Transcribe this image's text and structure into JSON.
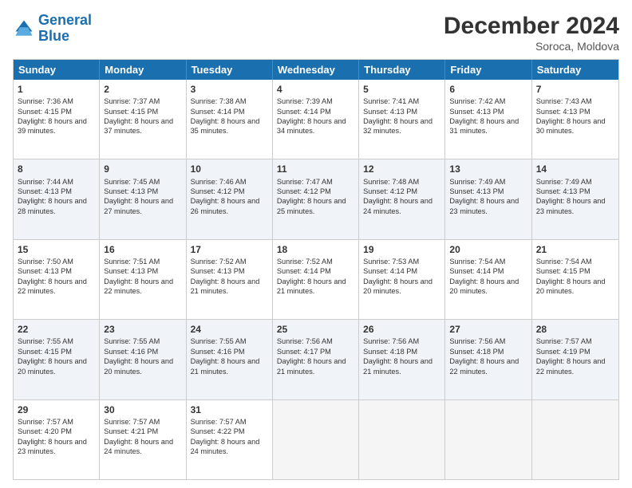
{
  "logo": {
    "line1": "General",
    "line2": "Blue"
  },
  "title": "December 2024",
  "subtitle": "Soroca, Moldova",
  "headers": [
    "Sunday",
    "Monday",
    "Tuesday",
    "Wednesday",
    "Thursday",
    "Friday",
    "Saturday"
  ],
  "rows": [
    [
      {
        "day": "1",
        "sunrise": "Sunrise: 7:36 AM",
        "sunset": "Sunset: 4:15 PM",
        "daylight": "Daylight: 8 hours and 39 minutes."
      },
      {
        "day": "2",
        "sunrise": "Sunrise: 7:37 AM",
        "sunset": "Sunset: 4:15 PM",
        "daylight": "Daylight: 8 hours and 37 minutes."
      },
      {
        "day": "3",
        "sunrise": "Sunrise: 7:38 AM",
        "sunset": "Sunset: 4:14 PM",
        "daylight": "Daylight: 8 hours and 35 minutes."
      },
      {
        "day": "4",
        "sunrise": "Sunrise: 7:39 AM",
        "sunset": "Sunset: 4:14 PM",
        "daylight": "Daylight: 8 hours and 34 minutes."
      },
      {
        "day": "5",
        "sunrise": "Sunrise: 7:41 AM",
        "sunset": "Sunset: 4:13 PM",
        "daylight": "Daylight: 8 hours and 32 minutes."
      },
      {
        "day": "6",
        "sunrise": "Sunrise: 7:42 AM",
        "sunset": "Sunset: 4:13 PM",
        "daylight": "Daylight: 8 hours and 31 minutes."
      },
      {
        "day": "7",
        "sunrise": "Sunrise: 7:43 AM",
        "sunset": "Sunset: 4:13 PM",
        "daylight": "Daylight: 8 hours and 30 minutes."
      }
    ],
    [
      {
        "day": "8",
        "sunrise": "Sunrise: 7:44 AM",
        "sunset": "Sunset: 4:13 PM",
        "daylight": "Daylight: 8 hours and 28 minutes."
      },
      {
        "day": "9",
        "sunrise": "Sunrise: 7:45 AM",
        "sunset": "Sunset: 4:13 PM",
        "daylight": "Daylight: 8 hours and 27 minutes."
      },
      {
        "day": "10",
        "sunrise": "Sunrise: 7:46 AM",
        "sunset": "Sunset: 4:12 PM",
        "daylight": "Daylight: 8 hours and 26 minutes."
      },
      {
        "day": "11",
        "sunrise": "Sunrise: 7:47 AM",
        "sunset": "Sunset: 4:12 PM",
        "daylight": "Daylight: 8 hours and 25 minutes."
      },
      {
        "day": "12",
        "sunrise": "Sunrise: 7:48 AM",
        "sunset": "Sunset: 4:12 PM",
        "daylight": "Daylight: 8 hours and 24 minutes."
      },
      {
        "day": "13",
        "sunrise": "Sunrise: 7:49 AM",
        "sunset": "Sunset: 4:13 PM",
        "daylight": "Daylight: 8 hours and 23 minutes."
      },
      {
        "day": "14",
        "sunrise": "Sunrise: 7:49 AM",
        "sunset": "Sunset: 4:13 PM",
        "daylight": "Daylight: 8 hours and 23 minutes."
      }
    ],
    [
      {
        "day": "15",
        "sunrise": "Sunrise: 7:50 AM",
        "sunset": "Sunset: 4:13 PM",
        "daylight": "Daylight: 8 hours and 22 minutes."
      },
      {
        "day": "16",
        "sunrise": "Sunrise: 7:51 AM",
        "sunset": "Sunset: 4:13 PM",
        "daylight": "Daylight: 8 hours and 22 minutes."
      },
      {
        "day": "17",
        "sunrise": "Sunrise: 7:52 AM",
        "sunset": "Sunset: 4:13 PM",
        "daylight": "Daylight: 8 hours and 21 minutes."
      },
      {
        "day": "18",
        "sunrise": "Sunrise: 7:52 AM",
        "sunset": "Sunset: 4:14 PM",
        "daylight": "Daylight: 8 hours and 21 minutes."
      },
      {
        "day": "19",
        "sunrise": "Sunrise: 7:53 AM",
        "sunset": "Sunset: 4:14 PM",
        "daylight": "Daylight: 8 hours and 20 minutes."
      },
      {
        "day": "20",
        "sunrise": "Sunrise: 7:54 AM",
        "sunset": "Sunset: 4:14 PM",
        "daylight": "Daylight: 8 hours and 20 minutes."
      },
      {
        "day": "21",
        "sunrise": "Sunrise: 7:54 AM",
        "sunset": "Sunset: 4:15 PM",
        "daylight": "Daylight: 8 hours and 20 minutes."
      }
    ],
    [
      {
        "day": "22",
        "sunrise": "Sunrise: 7:55 AM",
        "sunset": "Sunset: 4:15 PM",
        "daylight": "Daylight: 8 hours and 20 minutes."
      },
      {
        "day": "23",
        "sunrise": "Sunrise: 7:55 AM",
        "sunset": "Sunset: 4:16 PM",
        "daylight": "Daylight: 8 hours and 20 minutes."
      },
      {
        "day": "24",
        "sunrise": "Sunrise: 7:55 AM",
        "sunset": "Sunset: 4:16 PM",
        "daylight": "Daylight: 8 hours and 21 minutes."
      },
      {
        "day": "25",
        "sunrise": "Sunrise: 7:56 AM",
        "sunset": "Sunset: 4:17 PM",
        "daylight": "Daylight: 8 hours and 21 minutes."
      },
      {
        "day": "26",
        "sunrise": "Sunrise: 7:56 AM",
        "sunset": "Sunset: 4:18 PM",
        "daylight": "Daylight: 8 hours and 21 minutes."
      },
      {
        "day": "27",
        "sunrise": "Sunrise: 7:56 AM",
        "sunset": "Sunset: 4:18 PM",
        "daylight": "Daylight: 8 hours and 22 minutes."
      },
      {
        "day": "28",
        "sunrise": "Sunrise: 7:57 AM",
        "sunset": "Sunset: 4:19 PM",
        "daylight": "Daylight: 8 hours and 22 minutes."
      }
    ],
    [
      {
        "day": "29",
        "sunrise": "Sunrise: 7:57 AM",
        "sunset": "Sunset: 4:20 PM",
        "daylight": "Daylight: 8 hours and 23 minutes."
      },
      {
        "day": "30",
        "sunrise": "Sunrise: 7:57 AM",
        "sunset": "Sunset: 4:21 PM",
        "daylight": "Daylight: 8 hours and 24 minutes."
      },
      {
        "day": "31",
        "sunrise": "Sunrise: 7:57 AM",
        "sunset": "Sunset: 4:22 PM",
        "daylight": "Daylight: 8 hours and 24 minutes."
      },
      null,
      null,
      null,
      null
    ]
  ]
}
